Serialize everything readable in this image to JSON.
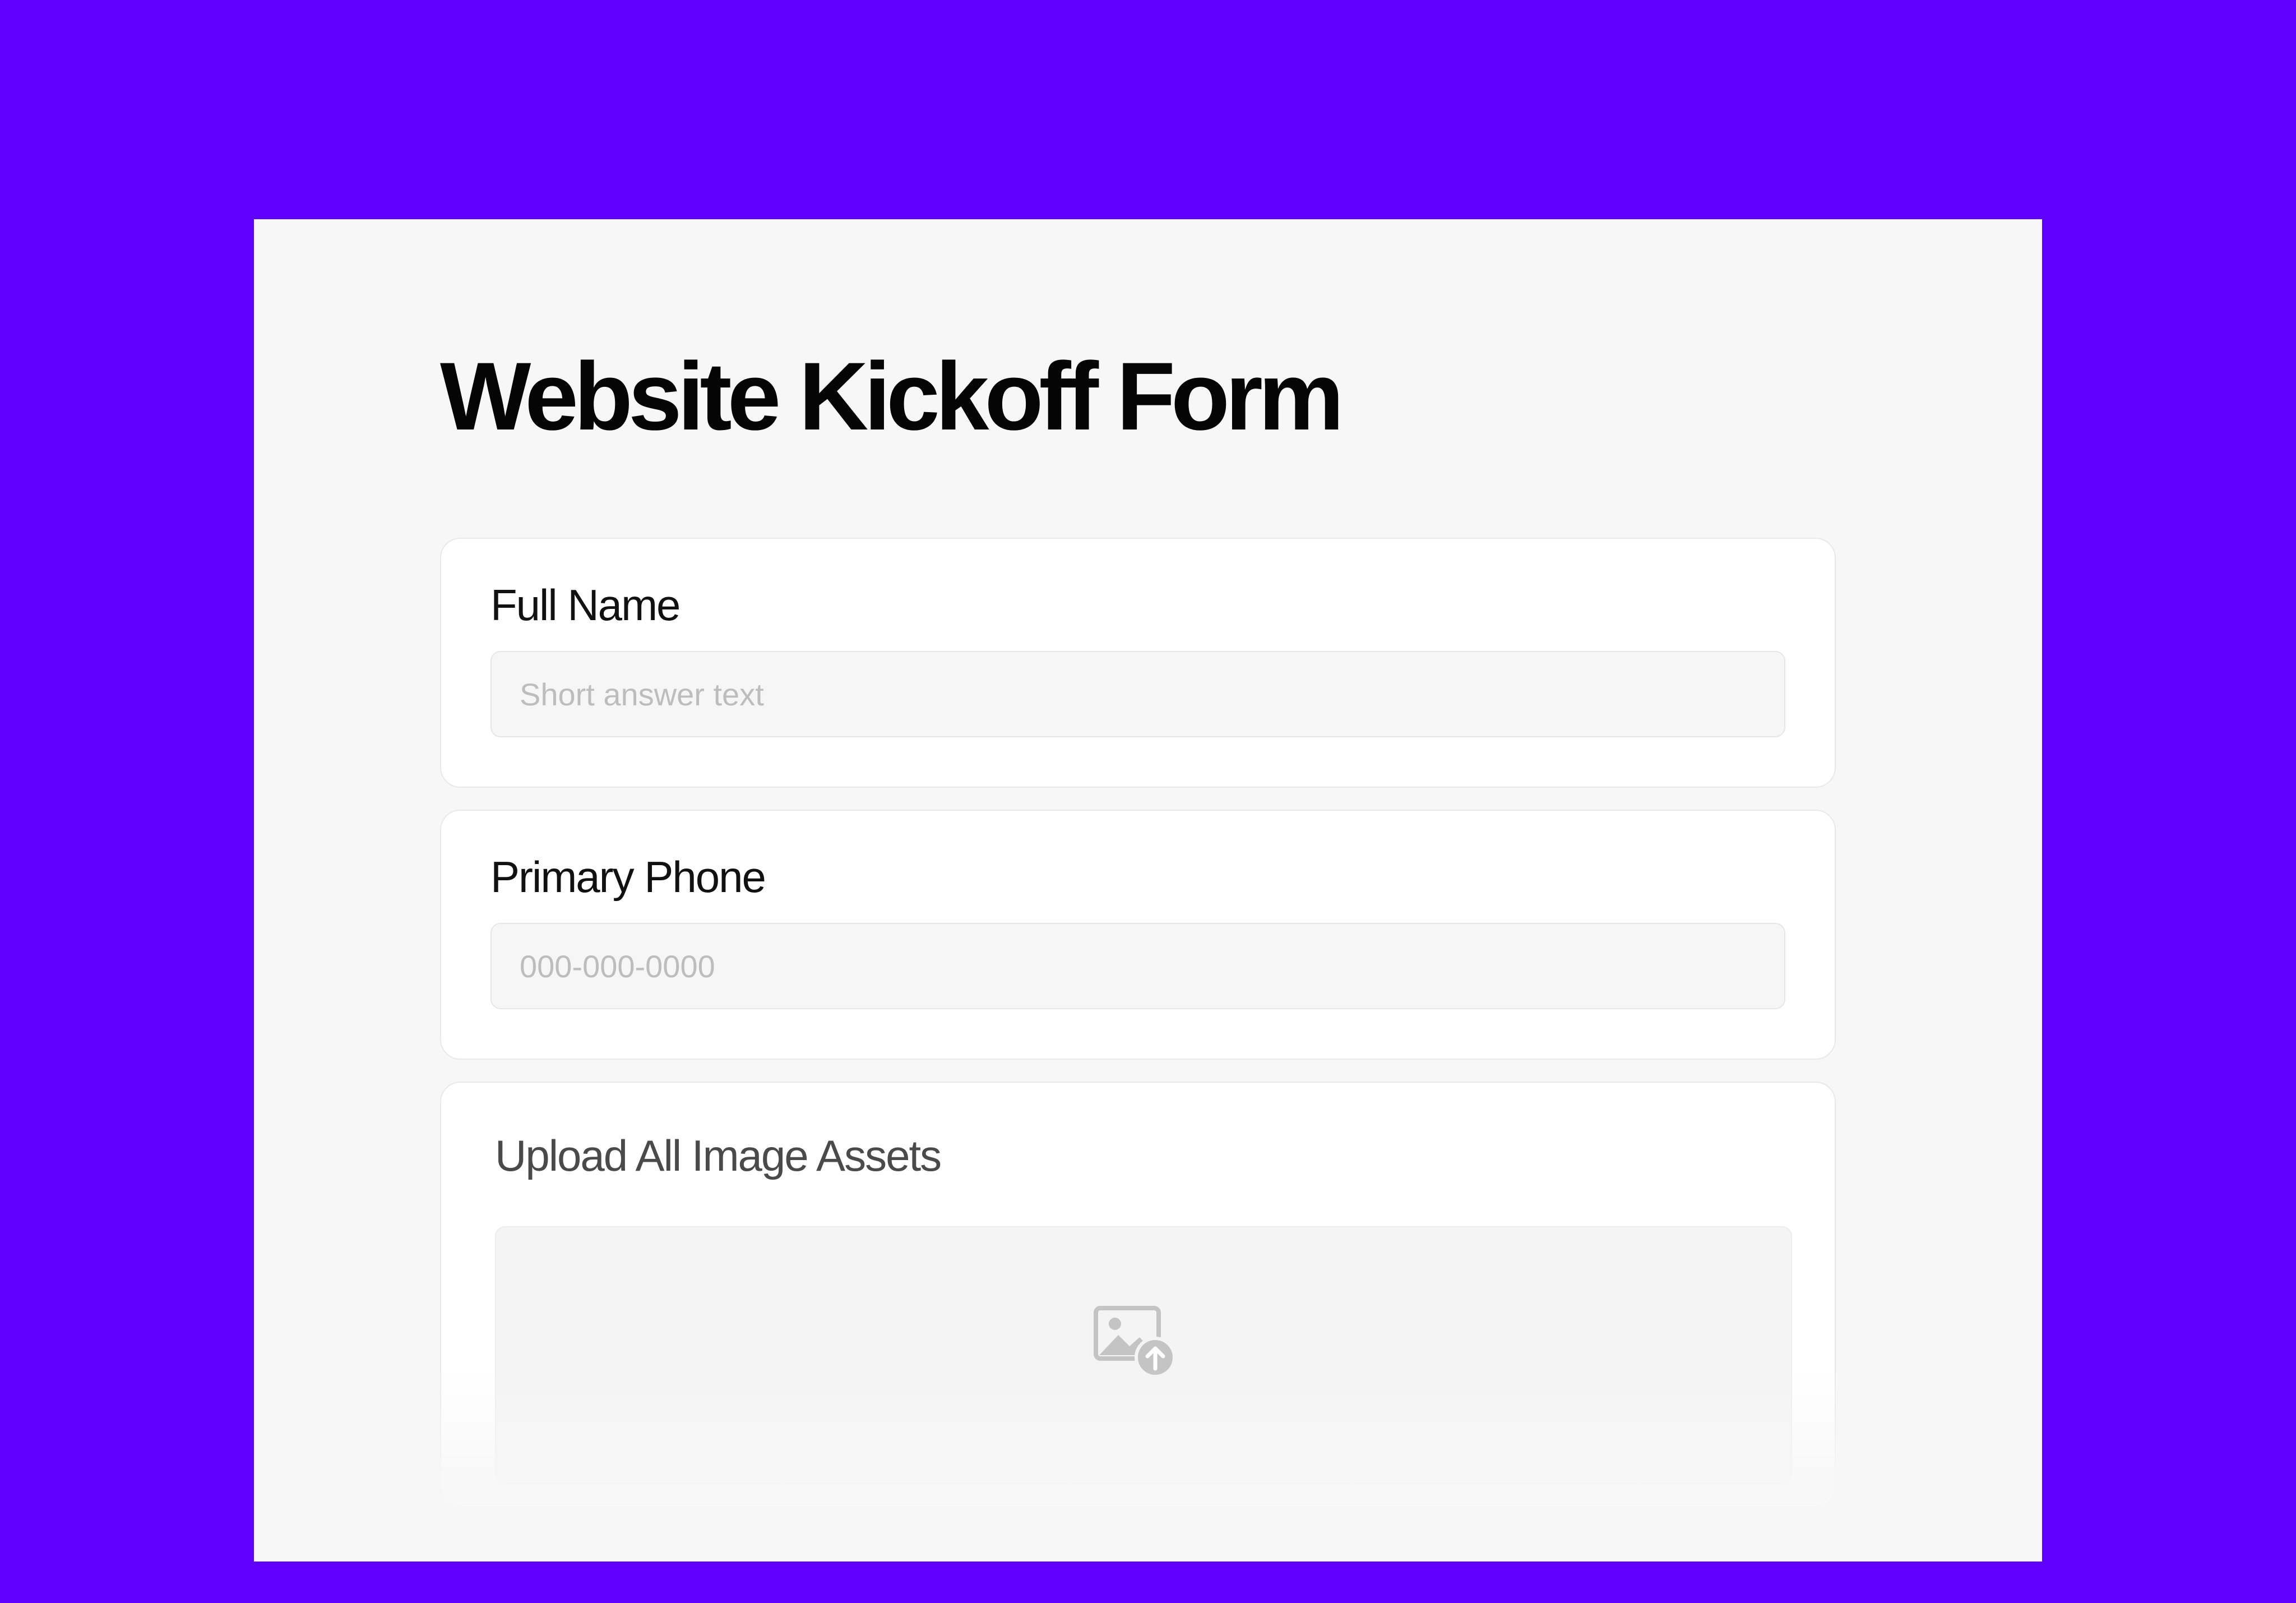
{
  "form": {
    "title": "Website Kickoff Form"
  },
  "fields": {
    "full_name": {
      "label": "Full Name",
      "placeholder": "Short answer text"
    },
    "primary_phone": {
      "label": "Primary Phone",
      "placeholder": "000-000-0000"
    },
    "image_upload": {
      "label": "Upload All Image Assets",
      "icon": "image-upload-icon"
    }
  },
  "colors": {
    "background": "#5f00ff",
    "page": "#f7f7f7",
    "card": "#ffffff",
    "title_text": "#050505",
    "placeholder": "#bdbdbd"
  }
}
